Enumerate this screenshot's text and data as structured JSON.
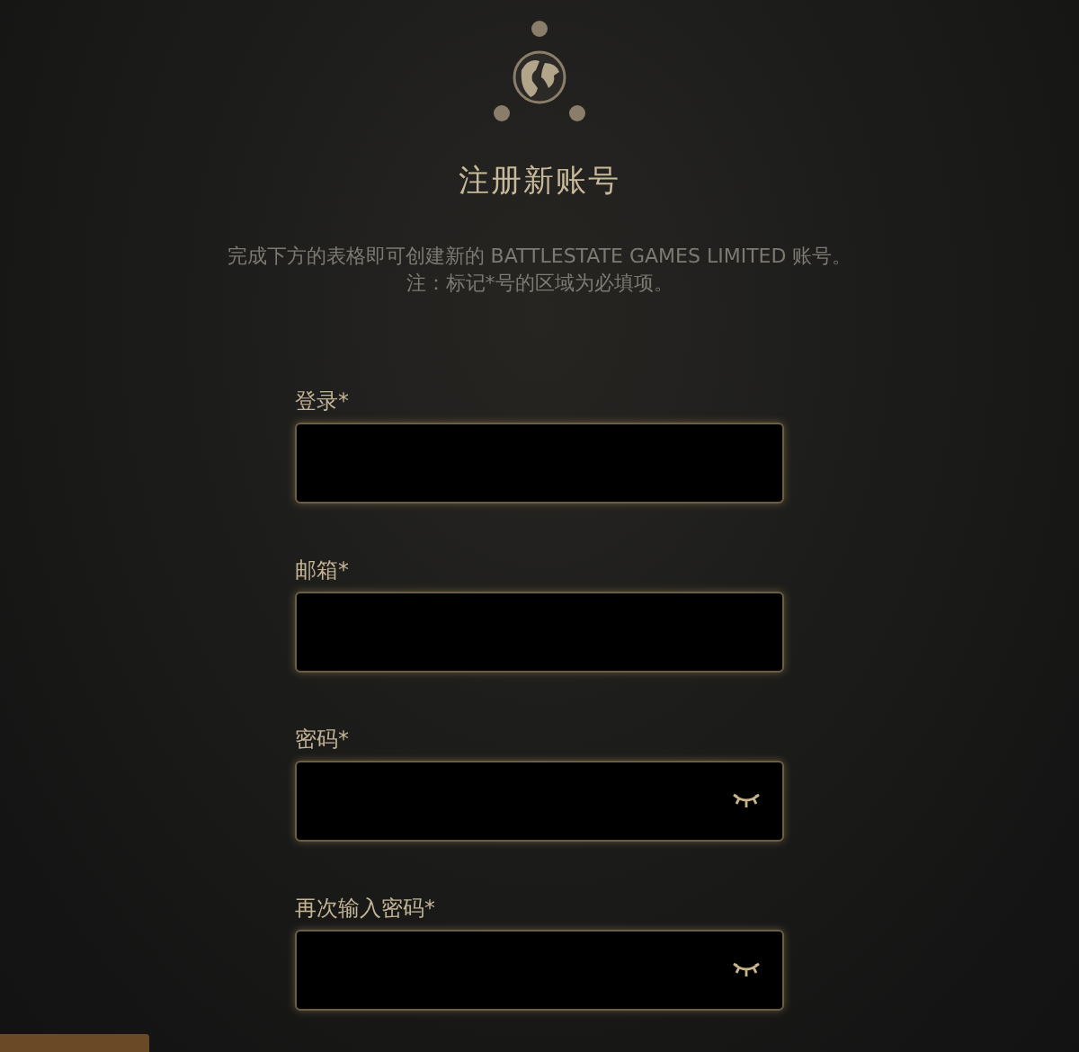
{
  "title": "注册新账号",
  "intro": [
    "完成下方的表格即可创建新的 BATTLESTATE GAMES LIMITED 账号。",
    "注：标记*号的区域为必填项。"
  ],
  "fields": [
    {
      "label": "登录*",
      "kind": "text"
    },
    {
      "label": "邮箱*",
      "kind": "text"
    },
    {
      "label": "密码*",
      "kind": "password"
    },
    {
      "label": "再次输入密码*",
      "kind": "password"
    }
  ]
}
